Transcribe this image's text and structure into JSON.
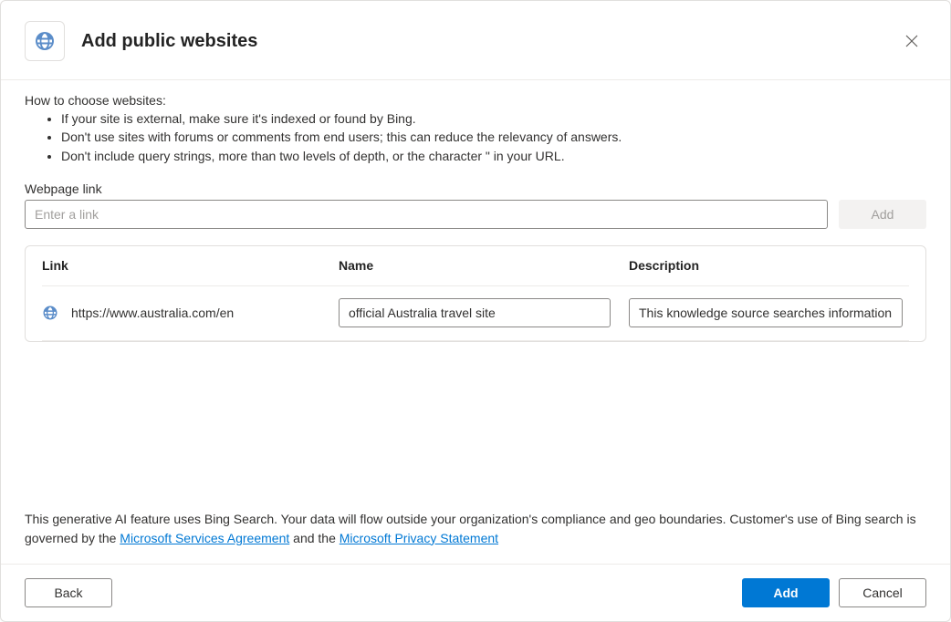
{
  "header": {
    "title": "Add public websites"
  },
  "intro": "How to choose websites:",
  "tips": [
    "If your site is external, make sure it's indexed or found by Bing.",
    "Don't use sites with forums or comments from end users; this can reduce the relevancy of answers.",
    "Don't include query strings, more than two levels of depth, or the character \" in your URL."
  ],
  "fields": {
    "webpage_link_label": "Webpage link",
    "link_placeholder": "Enter a link",
    "add_button": "Add"
  },
  "table": {
    "headers": {
      "link": "Link",
      "name": "Name",
      "description": "Description"
    },
    "rows": [
      {
        "link": "https://www.australia.com/en",
        "name": "official Australia travel site",
        "description": "This knowledge source searches information"
      }
    ]
  },
  "disclaimer": {
    "text_before": "This generative AI feature uses Bing Search. Your data will flow outside your organization's compliance and geo boundaries. Customer's use of Bing search is governed by the ",
    "link1": "Microsoft Services Agreement",
    "mid": " and the ",
    "link2": "Microsoft Privacy Statement"
  },
  "footer": {
    "back": "Back",
    "add": "Add",
    "cancel": "Cancel"
  }
}
